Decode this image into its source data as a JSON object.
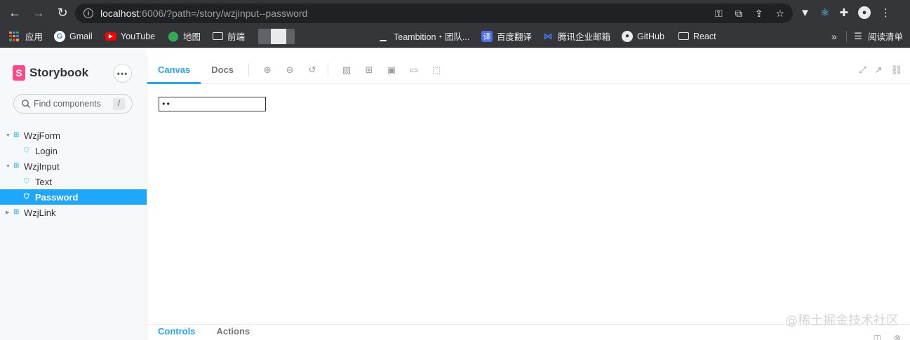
{
  "browser": {
    "url_host": "localhost",
    "url_rest": ":6006/?path=/story/wzjinput--password",
    "bookmarks": [
      {
        "label": "应用",
        "icon": "apps-grid-icon"
      },
      {
        "label": "Gmail",
        "icon": "google-icon"
      },
      {
        "label": "YouTube",
        "icon": "youtube-icon"
      },
      {
        "label": "地图",
        "icon": "maps-icon"
      },
      {
        "label": "前端",
        "icon": "folder-icon"
      },
      {
        "label": "Teambition・团队...",
        "icon": "teambition-icon"
      },
      {
        "label": "百度翻译",
        "icon": "baidu-translate-icon"
      },
      {
        "label": "腾讯企业邮箱",
        "icon": "tencent-mail-icon"
      },
      {
        "label": "GitHub",
        "icon": "github-icon"
      },
      {
        "label": "React",
        "icon": "folder-icon"
      }
    ],
    "overflow": "»",
    "reading_list": "阅读清单"
  },
  "sidebar": {
    "brand": "Storybook",
    "search_placeholder": "Find components",
    "search_shortcut": "/",
    "tree": [
      {
        "label": "WzjForm",
        "type": "component"
      },
      {
        "label": "Login",
        "type": "story"
      },
      {
        "label": "WzjInput",
        "type": "component"
      },
      {
        "label": "Text",
        "type": "story"
      },
      {
        "label": "Password",
        "type": "story",
        "selected": true
      },
      {
        "label": "WzjLink",
        "type": "component"
      }
    ]
  },
  "toolbar": {
    "tabs": [
      "Canvas",
      "Docs"
    ],
    "active_tab": "Canvas"
  },
  "canvas": {
    "password_value": "••"
  },
  "addons": {
    "tabs": [
      "Controls",
      "Actions"
    ]
  },
  "watermark": "@稀土掘金技术社区",
  "colors": {
    "accent": "#1ea7fd",
    "brand": "#ff4785",
    "chrome_bg": "#35363a"
  }
}
